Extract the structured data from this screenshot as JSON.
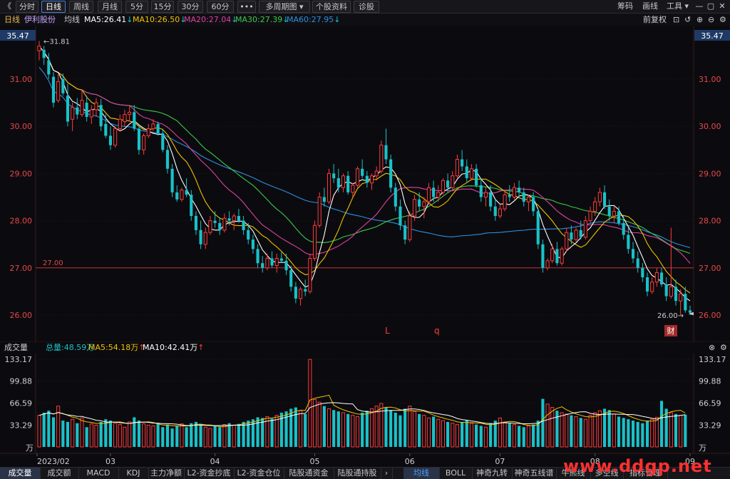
{
  "toolbar": {
    "back": "《",
    "tabs": [
      "分时",
      "日线",
      "周线",
      "月线",
      "5分",
      "15分",
      "30分",
      "60分",
      "•••",
      "多周期图 ▾",
      "个股资料",
      "诊股"
    ],
    "active_tab": 1,
    "right": [
      "筹码",
      "画线",
      "工具 ▾"
    ]
  },
  "info": {
    "period": "日线",
    "stock": "伊利股份",
    "ma_label": "均线",
    "ma5": "MA5:26.41",
    "ma10": "MA10:26.50",
    "ma20": "MA20:27.04",
    "ma30": "MA30:27.39",
    "ma60": "MA60:27.95",
    "fuquan": "前复权"
  },
  "vol_info": {
    "label": "成交量",
    "total": "总量:48.59万",
    "ma5": "MA5:54.18万",
    "ma10": "MA10:42.41万"
  },
  "colors": {
    "up": "#ff3b3b",
    "down": "#19c2c8",
    "ma5": "#ffffff",
    "ma10": "#f2c200",
    "ma20": "#e040a0",
    "ma30": "#3ec94a",
    "ma60": "#2e8fe0",
    "grid": "#2a1616"
  },
  "bottom_tabs_left": [
    "成交量",
    "成交额",
    "MACD",
    "KDJ",
    "主力净额",
    "L2-资金抄底",
    "L2-资金仓位",
    "陆股通资金",
    "陆股通持股",
    "›"
  ],
  "bottom_tabs_right": [
    "均线",
    "BOLL",
    "神奇九转",
    "神奇五线谱",
    "牛熊线",
    "多空线",
    "指标管理"
  ],
  "watermark": "www.ddgp.net",
  "chart_data": {
    "type": "candlestick",
    "price_axis": {
      "ticks": [
        "26.00",
        "27.00",
        "28.00",
        "29.00",
        "30.00",
        "31.00"
      ],
      "top_label": "35.47"
    },
    "volume_axis": {
      "ticks": [
        "133.17",
        "99.88",
        "66.59",
        "33.29"
      ],
      "unit": "万"
    },
    "x_labels": [
      "2023/02",
      "03",
      "04",
      "05",
      "06",
      "07",
      "08",
      "09"
    ],
    "x_label_days": [
      0,
      15,
      37,
      58,
      78,
      97,
      117,
      138
    ],
    "annotations": {
      "high": "31.81",
      "low": "26.00",
      "hline": "27.00",
      "marks": [
        "L",
        "q"
      ],
      "cai": "财"
    },
    "ohlc": [
      [
        31.6,
        31.81,
        31.4,
        31.7
      ],
      [
        31.62,
        31.7,
        31.3,
        31.45
      ],
      [
        31.4,
        31.55,
        31.0,
        31.1
      ],
      [
        31.05,
        31.15,
        30.4,
        30.5
      ],
      [
        30.55,
        31.1,
        30.5,
        30.95
      ],
      [
        31.0,
        31.12,
        30.65,
        30.7
      ],
      [
        30.65,
        30.9,
        30.0,
        30.1
      ],
      [
        30.15,
        30.5,
        29.9,
        30.4
      ],
      [
        30.4,
        30.6,
        30.15,
        30.25
      ],
      [
        30.25,
        30.75,
        30.2,
        30.55
      ],
      [
        30.5,
        30.65,
        30.1,
        30.2
      ],
      [
        30.2,
        30.45,
        30.05,
        30.35
      ],
      [
        30.35,
        30.6,
        30.2,
        30.5
      ],
      [
        30.45,
        30.58,
        29.9,
        30.0
      ],
      [
        30.05,
        30.25,
        29.75,
        29.8
      ],
      [
        29.8,
        30.0,
        29.5,
        29.6
      ],
      [
        29.6,
        30.0,
        29.55,
        29.95
      ],
      [
        29.95,
        30.25,
        29.9,
        30.15
      ],
      [
        30.1,
        30.35,
        30.0,
        30.25
      ],
      [
        30.25,
        30.45,
        30.1,
        30.3
      ],
      [
        30.3,
        30.45,
        29.9,
        29.95
      ],
      [
        29.95,
        30.0,
        29.4,
        29.5
      ],
      [
        29.5,
        29.85,
        29.4,
        29.8
      ],
      [
        29.8,
        30.05,
        29.75,
        29.95
      ],
      [
        29.95,
        30.15,
        29.9,
        30.05
      ],
      [
        30.05,
        30.1,
        29.8,
        29.85
      ],
      [
        29.85,
        29.95,
        29.45,
        29.5
      ],
      [
        29.5,
        29.6,
        29.0,
        29.1
      ],
      [
        29.1,
        29.2,
        28.5,
        28.6
      ],
      [
        28.6,
        28.75,
        28.4,
        28.45
      ],
      [
        28.45,
        28.7,
        28.4,
        28.65
      ],
      [
        28.65,
        28.9,
        28.5,
        28.55
      ],
      [
        28.55,
        28.65,
        28.0,
        28.1
      ],
      [
        28.1,
        28.2,
        27.7,
        27.8
      ],
      [
        27.8,
        28.0,
        27.4,
        27.5
      ],
      [
        27.5,
        27.85,
        27.4,
        27.75
      ],
      [
        27.75,
        28.1,
        27.7,
        28.0
      ],
      [
        28.0,
        28.2,
        27.85,
        27.95
      ],
      [
        27.95,
        28.05,
        27.7,
        27.8
      ],
      [
        27.8,
        28.15,
        27.75,
        28.05
      ],
      [
        28.05,
        28.2,
        27.9,
        28.0
      ],
      [
        28.0,
        28.15,
        27.8,
        28.1
      ],
      [
        28.1,
        28.25,
        27.95,
        28.0
      ],
      [
        28.0,
        28.1,
        27.7,
        27.8
      ],
      [
        27.8,
        27.95,
        27.5,
        27.6
      ],
      [
        27.6,
        27.7,
        27.3,
        27.4
      ],
      [
        27.4,
        27.5,
        27.0,
        27.1
      ],
      [
        27.1,
        27.25,
        26.9,
        27.0
      ],
      [
        27.0,
        27.3,
        26.95,
        27.2
      ],
      [
        27.2,
        27.35,
        27.0,
        27.05
      ],
      [
        27.05,
        27.3,
        26.9,
        27.2
      ],
      [
        27.2,
        27.35,
        27.1,
        27.15
      ],
      [
        27.15,
        27.3,
        26.85,
        26.95
      ],
      [
        26.95,
        27.05,
        26.5,
        26.6
      ],
      [
        26.6,
        26.7,
        26.25,
        26.35
      ],
      [
        26.35,
        26.6,
        26.2,
        26.55
      ],
      [
        26.55,
        26.75,
        26.4,
        26.5
      ],
      [
        26.5,
        27.3,
        26.45,
        27.2
      ],
      [
        27.2,
        28.0,
        27.15,
        27.9
      ],
      [
        27.9,
        28.6,
        27.85,
        28.5
      ],
      [
        28.5,
        28.7,
        28.3,
        28.4
      ],
      [
        28.4,
        29.1,
        28.35,
        29.0
      ],
      [
        29.0,
        29.2,
        28.8,
        28.9
      ],
      [
        28.9,
        29.1,
        28.6,
        28.7
      ],
      [
        28.7,
        29.0,
        28.6,
        28.95
      ],
      [
        28.95,
        29.05,
        28.55,
        28.6
      ],
      [
        28.6,
        28.8,
        28.5,
        28.75
      ],
      [
        28.75,
        29.15,
        28.7,
        29.1
      ],
      [
        29.1,
        29.3,
        28.9,
        28.95
      ],
      [
        28.95,
        29.05,
        28.7,
        28.8
      ],
      [
        28.8,
        29.0,
        28.65,
        28.95
      ],
      [
        28.95,
        29.15,
        28.85,
        29.05
      ],
      [
        29.05,
        29.7,
        29.0,
        29.6
      ],
      [
        29.6,
        29.95,
        29.2,
        29.3
      ],
      [
        29.3,
        29.4,
        28.6,
        28.7
      ],
      [
        28.7,
        28.8,
        28.2,
        28.3
      ],
      [
        28.3,
        28.45,
        27.8,
        27.9
      ],
      [
        27.9,
        28.0,
        27.5,
        27.6
      ],
      [
        27.6,
        28.2,
        27.55,
        28.1
      ],
      [
        28.1,
        28.55,
        28.0,
        28.45
      ],
      [
        28.45,
        28.6,
        28.2,
        28.3
      ],
      [
        28.3,
        28.5,
        28.05,
        28.4
      ],
      [
        28.4,
        28.8,
        28.35,
        28.7
      ],
      [
        28.7,
        28.85,
        28.4,
        28.5
      ],
      [
        28.5,
        28.75,
        28.4,
        28.6
      ],
      [
        28.6,
        28.9,
        28.55,
        28.85
      ],
      [
        28.85,
        29.0,
        28.6,
        28.7
      ],
      [
        28.7,
        29.05,
        28.65,
        28.95
      ],
      [
        28.95,
        29.4,
        28.9,
        29.3
      ],
      [
        29.3,
        29.5,
        29.05,
        29.15
      ],
      [
        29.15,
        29.3,
        28.8,
        28.9
      ],
      [
        28.9,
        29.2,
        28.85,
        29.1
      ],
      [
        29.1,
        29.2,
        28.7,
        28.75
      ],
      [
        28.75,
        28.9,
        28.4,
        28.5
      ],
      [
        28.5,
        28.7,
        28.3,
        28.6
      ],
      [
        28.6,
        28.75,
        28.2,
        28.3
      ],
      [
        28.3,
        28.45,
        28.0,
        28.1
      ],
      [
        28.1,
        28.35,
        28.05,
        28.25
      ],
      [
        28.25,
        28.65,
        28.2,
        28.55
      ],
      [
        28.55,
        28.75,
        28.4,
        28.5
      ],
      [
        28.5,
        28.8,
        28.45,
        28.7
      ],
      [
        28.7,
        28.85,
        28.5,
        28.6
      ],
      [
        28.6,
        28.7,
        28.3,
        28.4
      ],
      [
        28.4,
        28.55,
        28.2,
        28.5
      ],
      [
        28.5,
        28.6,
        28.1,
        28.2
      ],
      [
        28.2,
        28.25,
        27.4,
        27.5
      ],
      [
        27.5,
        27.6,
        26.9,
        27.0
      ],
      [
        27.0,
        27.2,
        26.95,
        27.15
      ],
      [
        27.15,
        27.5,
        27.1,
        27.4
      ],
      [
        27.4,
        27.55,
        27.05,
        27.1
      ],
      [
        27.1,
        27.45,
        27.05,
        27.4
      ],
      [
        27.4,
        27.85,
        27.35,
        27.75
      ],
      [
        27.75,
        27.9,
        27.5,
        27.6
      ],
      [
        27.6,
        27.85,
        27.55,
        27.8
      ],
      [
        27.8,
        28.0,
        27.6,
        27.65
      ],
      [
        27.65,
        28.1,
        27.6,
        28.0
      ],
      [
        28.0,
        28.3,
        27.95,
        28.2
      ],
      [
        28.2,
        28.5,
        28.1,
        28.4
      ],
      [
        28.4,
        28.7,
        28.3,
        28.6
      ],
      [
        28.6,
        28.75,
        28.25,
        28.3
      ],
      [
        28.3,
        28.45,
        28.0,
        28.1
      ],
      [
        28.1,
        28.3,
        27.95,
        28.2
      ],
      [
        28.2,
        28.3,
        27.9,
        27.95
      ],
      [
        27.95,
        28.1,
        27.6,
        27.7
      ],
      [
        27.7,
        27.85,
        27.3,
        27.4
      ],
      [
        27.4,
        27.55,
        27.1,
        27.2
      ],
      [
        27.2,
        27.35,
        26.9,
        27.0
      ],
      [
        27.0,
        27.1,
        26.7,
        26.8
      ],
      [
        26.8,
        26.9,
        26.4,
        26.5
      ],
      [
        26.5,
        26.8,
        26.45,
        26.7
      ],
      [
        26.7,
        27.0,
        26.6,
        26.9
      ],
      [
        26.9,
        27.0,
        26.6,
        26.65
      ],
      [
        26.65,
        26.8,
        26.3,
        26.4
      ],
      [
        26.4,
        27.85,
        26.35,
        26.6
      ],
      [
        26.6,
        26.75,
        26.2,
        26.3
      ],
      [
        26.3,
        26.55,
        26.0,
        26.45
      ],
      [
        26.45,
        26.6,
        26.05,
        26.1
      ],
      [
        26.1,
        26.2,
        26.0,
        26.05
      ]
    ],
    "volume": [
      48,
      52,
      55,
      45,
      62,
      40,
      38,
      42,
      36,
      44,
      30,
      35,
      33,
      38,
      42,
      40,
      36,
      34,
      30,
      38,
      45,
      40,
      35,
      33,
      32,
      36,
      30,
      34,
      28,
      32,
      35,
      30,
      36,
      38,
      34,
      30,
      28,
      32,
      30,
      34,
      36,
      33,
      35,
      38,
      40,
      42,
      45,
      44,
      46,
      43,
      48,
      52,
      54,
      58,
      60,
      55,
      50,
      133,
      72,
      68,
      62,
      58,
      56,
      54,
      52,
      50,
      48,
      46,
      52,
      55,
      58,
      62,
      66,
      60,
      56,
      52,
      48,
      58,
      62,
      54,
      50,
      48,
      44,
      46,
      42,
      40,
      38,
      36,
      34,
      38,
      40,
      36,
      34,
      32,
      30,
      36,
      40,
      44,
      38,
      36,
      34,
      32,
      30,
      32,
      34,
      40,
      73,
      65,
      60,
      55,
      52,
      50,
      48,
      46,
      44,
      42,
      48,
      52,
      55,
      58,
      56,
      50,
      46,
      44,
      42,
      40,
      38,
      36,
      40,
      42,
      45,
      70,
      58,
      52,
      50,
      48,
      49
    ]
  }
}
